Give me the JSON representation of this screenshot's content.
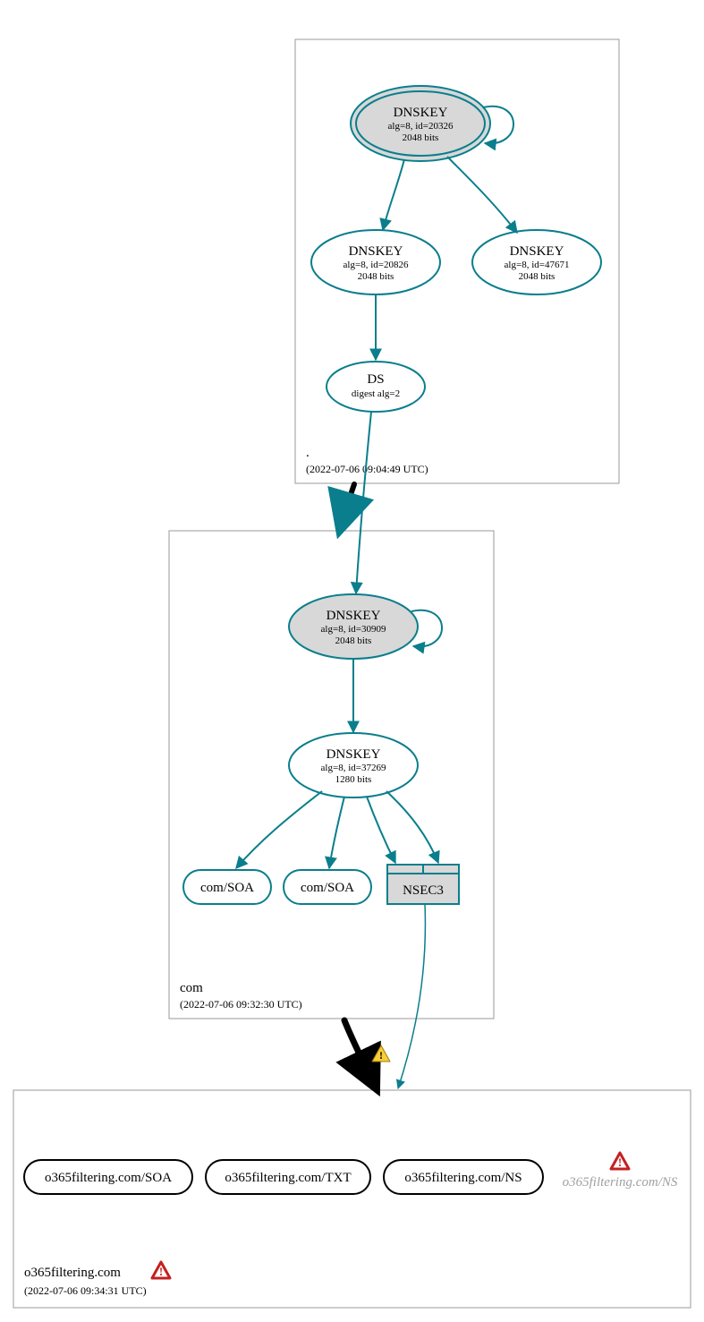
{
  "colors": {
    "teal": "#0a7e8c",
    "gray_fill": "#d8d8d8",
    "zone_border": "#9a9a9a",
    "inner_zone_bg": "#ffffff"
  },
  "zones": {
    "root": {
      "name": ".",
      "timestamp": "(2022-07-06 09:04:49 UTC)"
    },
    "com": {
      "name": "com",
      "timestamp": "(2022-07-06 09:32:30 UTC)"
    },
    "o365": {
      "name": "o365filtering.com",
      "timestamp": "(2022-07-06 09:34:31 UTC)"
    }
  },
  "nodes": {
    "root_ksk": {
      "title": "DNSKEY",
      "sub1": "alg=8, id=20326",
      "sub2": "2048 bits"
    },
    "root_zsk1": {
      "title": "DNSKEY",
      "sub1": "alg=8, id=20826",
      "sub2": "2048 bits"
    },
    "root_zsk2": {
      "title": "DNSKEY",
      "sub1": "alg=8, id=47671",
      "sub2": "2048 bits"
    },
    "root_ds": {
      "title": "DS",
      "sub1": "digest alg=2"
    },
    "com_ksk": {
      "title": "DNSKEY",
      "sub1": "alg=8, id=30909",
      "sub2": "2048 bits"
    },
    "com_zsk": {
      "title": "DNSKEY",
      "sub1": "alg=8, id=37269",
      "sub2": "1280 bits"
    },
    "com_soa1": {
      "title": "com/SOA"
    },
    "com_soa2": {
      "title": "com/SOA"
    },
    "nsec3": {
      "title": "NSEC3"
    },
    "o365_soa": {
      "title": "o365filtering.com/SOA"
    },
    "o365_txt": {
      "title": "o365filtering.com/TXT"
    },
    "o365_ns": {
      "title": "o365filtering.com/NS"
    },
    "o365_ns_gray": {
      "title": "o365filtering.com/NS"
    }
  }
}
